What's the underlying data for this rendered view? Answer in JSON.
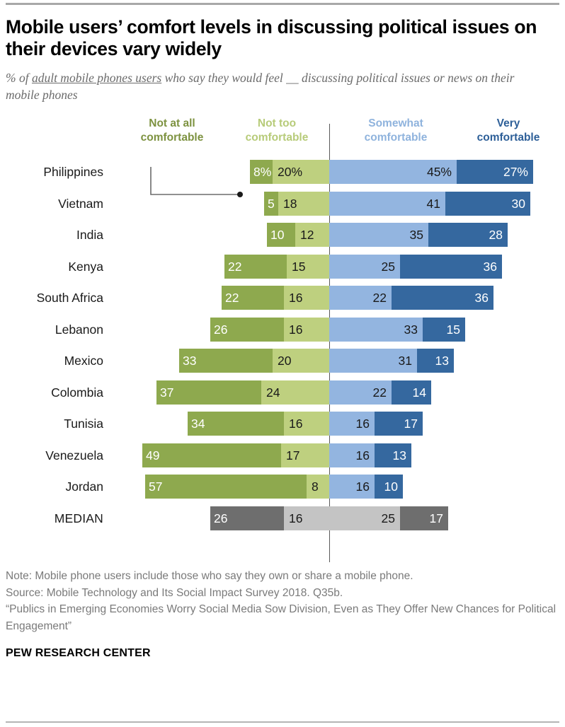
{
  "title": "Mobile users’ comfort levels in discussing political issues on their devices vary widely",
  "subtitle_part1": "% of ",
  "subtitle_underline": "adult mobile phones users",
  "subtitle_part2": " who say they would feel __ discussing political issues or news on their mobile phones",
  "legend": [
    {
      "label_line1": "Not at all",
      "label_line2": "comfortable",
      "color": "#7d9240"
    },
    {
      "label_line1": "Not too",
      "label_line2": "comfortable",
      "color": "#b7cb79"
    },
    {
      "label_line1": "Somewhat",
      "label_line2": "comfortable",
      "color": "#8fb3dd"
    },
    {
      "label_line1": "Very",
      "label_line2": "comfortable",
      "color": "#2d5f98"
    }
  ],
  "footer": {
    "note": "Note: Mobile phone users include those who say they own or share a mobile phone.",
    "source": "Source: Mobile Technology and Its Social Impact Survey 2018. Q35b.",
    "report": "“Publics in Emerging Economies Worry Social Media Sow Division, Even as They Offer New Chances for Political Engagement”",
    "brand": "PEW RESEARCH CENTER"
  },
  "chart_data": {
    "type": "bar",
    "subtype": "diverging-stacked-bar",
    "title": "Mobile users’ comfort levels in discussing political issues on their devices vary widely",
    "xlabel": "",
    "ylabel": "",
    "categories": [
      "Philippines",
      "Vietnam",
      "India",
      "Kenya",
      "South Africa",
      "Lebanon",
      "Mexico",
      "Colombia",
      "Tunisia",
      "Venezuela",
      "Jordan",
      "MEDIAN"
    ],
    "series": [
      {
        "name": "Not at all comfortable",
        "color": "#8ea94e",
        "side": "left",
        "values": [
          8,
          5,
          10,
          22,
          22,
          26,
          33,
          37,
          34,
          49,
          57,
          26
        ]
      },
      {
        "name": "Not too comfortable",
        "color": "#bed07f",
        "side": "left",
        "values": [
          20,
          18,
          12,
          15,
          16,
          16,
          20,
          24,
          16,
          17,
          8,
          16
        ]
      },
      {
        "name": "Somewhat comfortable",
        "color": "#93b5e0",
        "side": "right",
        "values": [
          45,
          41,
          35,
          25,
          22,
          33,
          31,
          22,
          16,
          16,
          16,
          25
        ]
      },
      {
        "name": "Very comfortable",
        "color": "#35689f",
        "side": "right",
        "values": [
          27,
          30,
          28,
          36,
          36,
          15,
          13,
          14,
          17,
          13,
          10,
          17
        ]
      }
    ],
    "value_labels": {
      "Philippines": [
        "8%",
        "20%",
        "45%",
        "27%"
      ],
      "Vietnam": [
        "5",
        "18",
        "41",
        "30"
      ],
      "India": [
        "10",
        "12",
        "35",
        "28"
      ],
      "Kenya": [
        "22",
        "15",
        "25",
        "36"
      ],
      "South Africa": [
        "22",
        "16",
        "22",
        "36"
      ],
      "Lebanon": [
        "26",
        "16",
        "33",
        "15"
      ],
      "Mexico": [
        "33",
        "20",
        "31",
        "13"
      ],
      "Colombia": [
        "37",
        "24",
        "22",
        "14"
      ],
      "Tunisia": [
        "34",
        "16",
        "16",
        "17"
      ],
      "Venezuela": [
        "49",
        "17",
        "16",
        "13"
      ],
      "Jordan": [
        "57",
        "8",
        "16",
        "10"
      ],
      "MEDIAN": [
        "26",
        "16",
        "25",
        "17"
      ]
    },
    "median_row_colors": [
      "#6e6e6e",
      "#c4c4c4",
      "#c4c4c4",
      "#6e6e6e"
    ],
    "legend_position": "top",
    "grid": false,
    "center_baseline": 0,
    "units": "percent",
    "annotation": {
      "text": "leader line from “Not at all comfortable” legend to Philippines first segment",
      "target_row": "Philippines"
    }
  }
}
